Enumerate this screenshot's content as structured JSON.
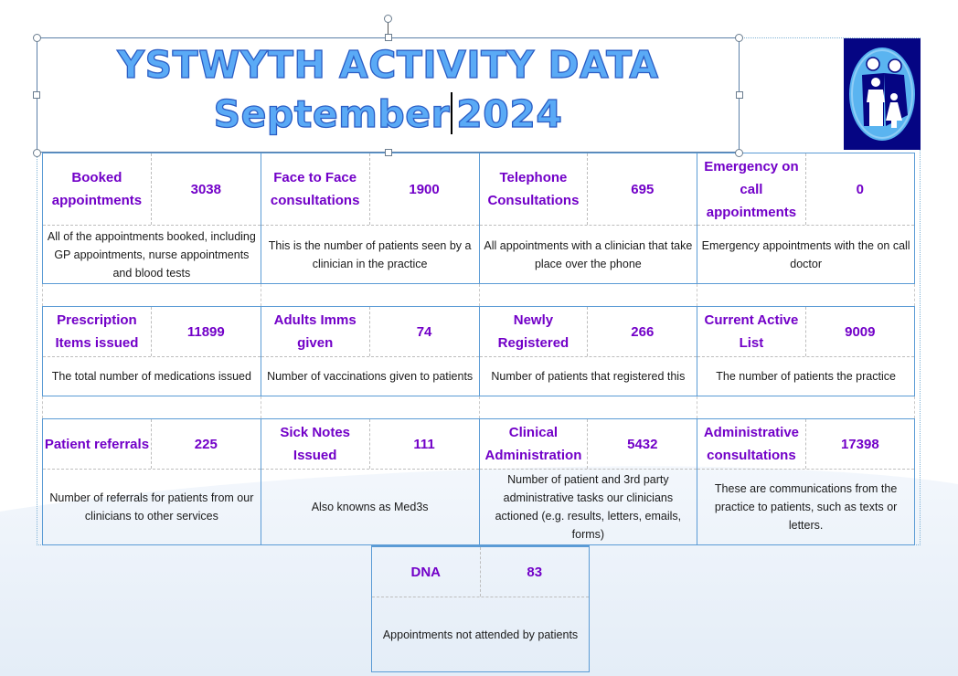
{
  "header": {
    "title_line1": "YSTWYTH ACTIVITY DATA",
    "title_month": "September",
    "title_year": "2024",
    "logo_icon": "family-logo-icon"
  },
  "colors": {
    "title_fill": "#5aaaf6",
    "title_outline": "#2a5dc4",
    "metric_text": "#7200c8",
    "border": "#5b9bd5",
    "logo_bg": "#050583",
    "logo_oval": "#5ab4f0"
  },
  "metrics": [
    {
      "label": "Booked appointments",
      "value": "3038",
      "description": "All of the appointments booked, including GP appointments, nurse appointments and blood tests"
    },
    {
      "label": "Face to Face consultations",
      "value": "1900",
      "description": "This is the number of patients seen by a clinician in the practice"
    },
    {
      "label": "Telephone Consultations",
      "value": "695",
      "description": "All appointments with a clinician that take place over the phone"
    },
    {
      "label": "Emergency on call appointments",
      "value": "0",
      "description": "Emergency appointments with the on call doctor"
    },
    {
      "label": "Prescription Items issued",
      "value": "11899",
      "description": "The total number of medications issued"
    },
    {
      "label": "Adults Imms given",
      "value": "74",
      "description": "Number of vaccinations given to patients"
    },
    {
      "label": "Newly Registered",
      "value": "266",
      "description": "Number of patients that registered this"
    },
    {
      "label": "Current Active List",
      "value": "9009",
      "description": "The number of patients the practice"
    },
    {
      "label": "Patient referrals",
      "value": "225",
      "description": "Number of referrals for patients from our clinicians to other services"
    },
    {
      "label": "Sick Notes Issued",
      "value": "111",
      "description": "Also knowns as Med3s"
    },
    {
      "label": "Clinical Administration",
      "value": "5432",
      "description": "Number of patient and 3rd party administrative tasks our clinicians actioned (e.g. results, letters, emails, forms)"
    },
    {
      "label": "Administrative consultations",
      "value": "17398",
      "description": "These are communications from the practice to patients, such as texts or letters."
    },
    {
      "label": "DNA",
      "value": "83",
      "description": "Appointments not attended by patients"
    }
  ]
}
